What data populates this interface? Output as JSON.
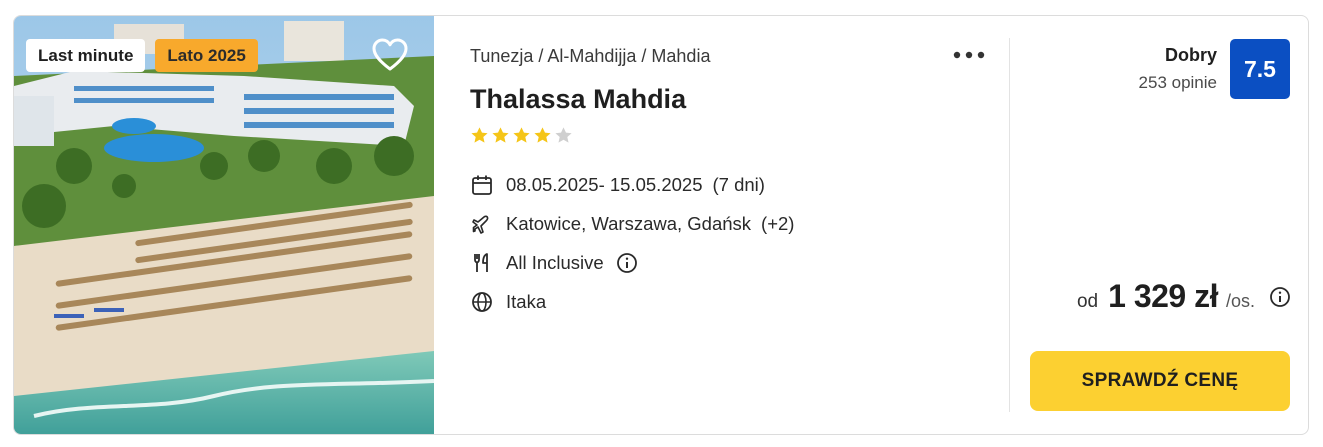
{
  "badges": {
    "last_minute": "Last minute",
    "season": "Lato 2025"
  },
  "hotel": {
    "breadcrumb": "Tunezja / Al-Mahdijja / Mahdia",
    "name": "Thalassa Mahdia",
    "stars": 4,
    "max_stars": 5
  },
  "details": {
    "dates": "08.05.2025- 15.05.2025",
    "duration": "(7 dni)",
    "airports": "Katowice, Warszawa, Gdańsk",
    "airports_more": "(+2)",
    "board": "All Inclusive",
    "operator": "Itaka"
  },
  "rating": {
    "label": "Dobry",
    "count": "253 opinie",
    "score": "7.5"
  },
  "price": {
    "prefix": "od",
    "value": "1 329 zł",
    "suffix": "/os."
  },
  "cta": {
    "label": "SPRAWDŹ CENĘ"
  },
  "colors": {
    "accent_yellow": "#fcd031",
    "rating_blue": "#0b4fc2",
    "badge_orange": "#f8a92c",
    "star_gold": "#f5c518",
    "star_empty": "#cfcfcf"
  },
  "icons": {
    "favorite": "heart-icon",
    "more": "more-dots-icon",
    "dates": "calendar-icon",
    "airports": "plane-icon",
    "board": "cutlery-icon",
    "operator": "globe-icon",
    "info": "info-icon"
  }
}
